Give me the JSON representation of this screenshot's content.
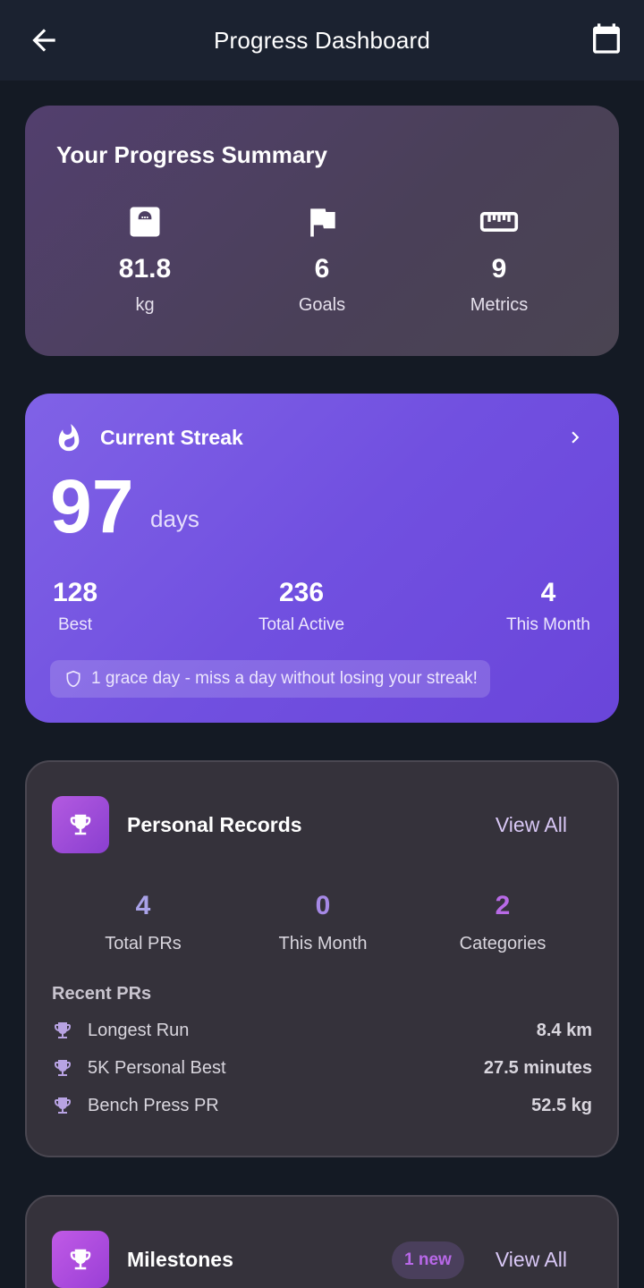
{
  "header": {
    "title": "Progress Dashboard",
    "back_icon": "arrow-left-icon",
    "calendar_icon": "calendar-icon"
  },
  "summary": {
    "title": "Your Progress Summary",
    "stats": [
      {
        "icon": "scale-icon",
        "value": "81.8",
        "label": "kg"
      },
      {
        "icon": "flag-icon",
        "value": "6",
        "label": "Goals"
      },
      {
        "icon": "ruler-icon",
        "value": "9",
        "label": "Metrics"
      }
    ]
  },
  "streak": {
    "title": "Current Streak",
    "value": "97",
    "unit": "days",
    "stats": [
      {
        "value": "128",
        "label": "Best"
      },
      {
        "value": "236",
        "label": "Total Active"
      },
      {
        "value": "4",
        "label": "This Month"
      }
    ],
    "grace_text": "1 grace day - miss a day without losing your streak!",
    "colors": {
      "start": "#8062e6",
      "end": "#6a45da"
    }
  },
  "records": {
    "title": "Personal Records",
    "view_all": "View All",
    "stats": [
      {
        "value": "4",
        "label": "Total PRs",
        "color": "#a9a2e8"
      },
      {
        "value": "0",
        "label": "This Month",
        "color": "#a689e6"
      },
      {
        "value": "2",
        "label": "Categories",
        "color": "#b86ae6"
      }
    ],
    "recent_label": "Recent PRs",
    "items": [
      {
        "name": "Longest Run",
        "value": "8.4 km"
      },
      {
        "name": "5K Personal Best",
        "value": "27.5 minutes"
      },
      {
        "name": "Bench Press PR",
        "value": "52.5 kg"
      }
    ]
  },
  "milestones": {
    "title": "Milestones",
    "badge_text": "1 new",
    "view_all": "View All"
  }
}
